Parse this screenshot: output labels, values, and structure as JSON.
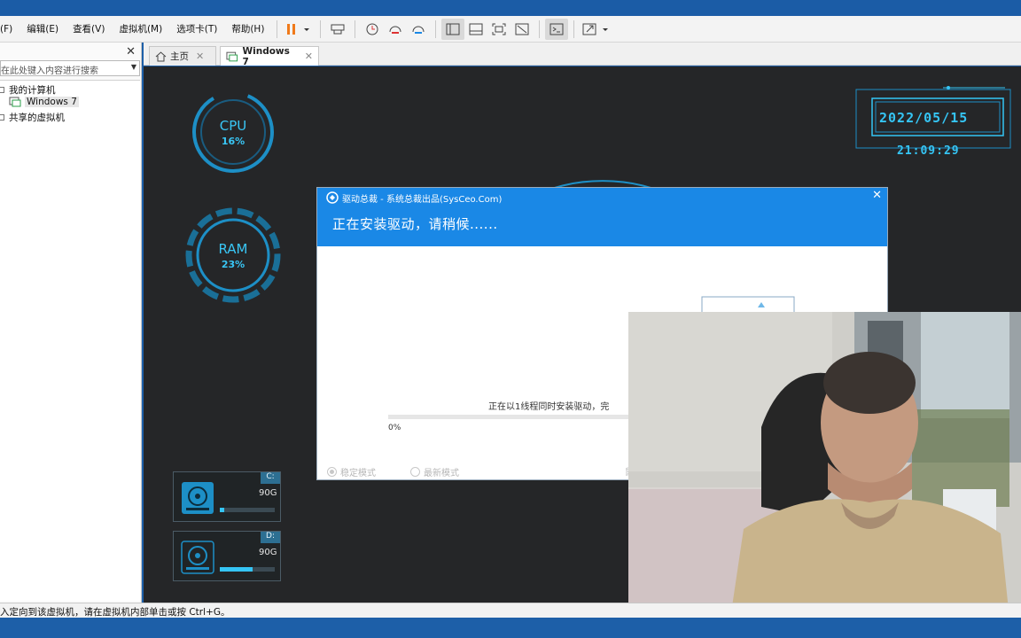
{
  "menubar": {
    "items": [
      "(F)",
      "编辑(E)",
      "查看(V)",
      "虚拟机(M)",
      "选项卡(T)",
      "帮助(H)"
    ]
  },
  "sidebar": {
    "close": "✕",
    "search_placeholder": "在此处键入内容进行搜索",
    "tree": [
      {
        "label": "我的计算机"
      },
      {
        "label": "Windows 7"
      },
      {
        "label": "共享的虚拟机"
      }
    ]
  },
  "tabs": [
    {
      "label": "主页"
    },
    {
      "label": "Windows 7"
    }
  ],
  "vm": {
    "cpu": {
      "label": "CPU",
      "value": "16%"
    },
    "ram": {
      "label": "RAM",
      "value": "23%"
    },
    "clock": {
      "date": "2022/05/15",
      "time": "21:09:29"
    },
    "drives": [
      {
        "letter": "C:",
        "size": "90G",
        "usage": 0.08
      },
      {
        "letter": "D:",
        "size": "90G",
        "usage": 0.6
      }
    ]
  },
  "dialog": {
    "title": "驱动总裁 - 系统总裁出品(SysCeo.Com)",
    "heading": "正在安装驱动，请稍候......",
    "status": "正在以1线程同时安装驱动，完",
    "progress": 0,
    "percent": "0%",
    "mode_stable": "稳定模式",
    "mode_latest": "最新模式",
    "more": "鼠"
  },
  "status_bar": {
    "text": "入定向到该虚拟机，请在虚拟机内部单击或按 Ctrl+G。"
  },
  "colors": {
    "accent": "#1a88e6",
    "neon": "#35c5f5",
    "vm_bg": "#252628",
    "title_strip": "#1b5ca6"
  }
}
